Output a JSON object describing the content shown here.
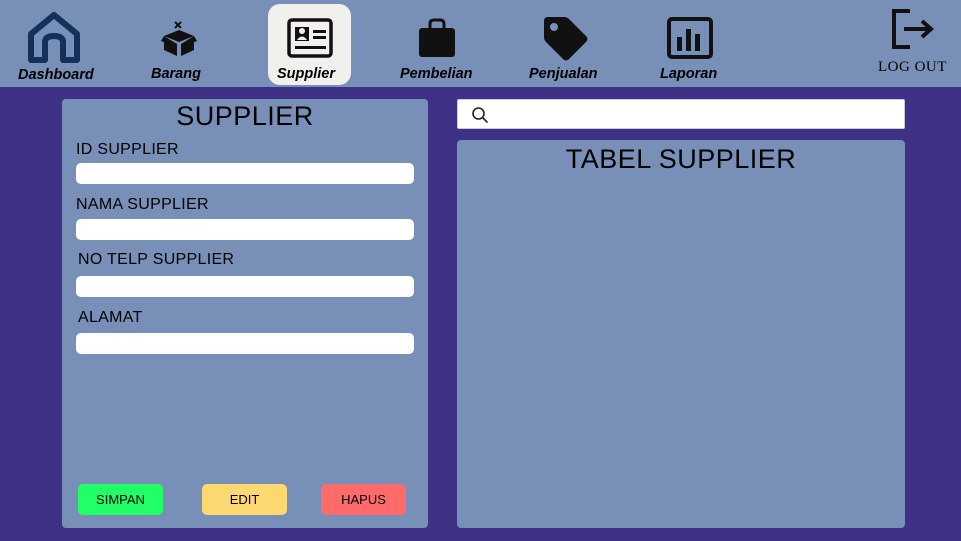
{
  "nav": {
    "items": [
      {
        "label": "Dashboard",
        "icon": "home-icon"
      },
      {
        "label": "Barang",
        "icon": "box-icon"
      },
      {
        "label": "Supplier",
        "icon": "contact-card-icon",
        "active": true
      },
      {
        "label": "Pembelian",
        "icon": "shopping-bag-icon"
      },
      {
        "label": "Penjualan",
        "icon": "price-tag-icon"
      },
      {
        "label": "Laporan",
        "icon": "bar-chart-icon"
      }
    ],
    "logout_label": "LOG OUT",
    "logout_icon": "logout-icon"
  },
  "form": {
    "title": "SUPPLIER",
    "fields": [
      {
        "label": "ID SUPPLIER",
        "value": ""
      },
      {
        "label": "NAMA SUPPLIER",
        "value": ""
      },
      {
        "label": "NO TELP SUPPLIER",
        "value": ""
      },
      {
        "label": "ALAMAT",
        "value": ""
      }
    ],
    "buttons": {
      "save": "SIMPAN",
      "edit": "EDIT",
      "delete": "HAPUS"
    }
  },
  "search": {
    "value": "",
    "icon": "search-icon"
  },
  "table": {
    "title": "TABEL SUPPLIER"
  },
  "colors": {
    "background": "#3f3186",
    "panel": "#7890b8",
    "active_tab": "#f2f0ec",
    "save": "#22ff66",
    "edit": "#fbd870",
    "delete": "#ff6a6a"
  }
}
